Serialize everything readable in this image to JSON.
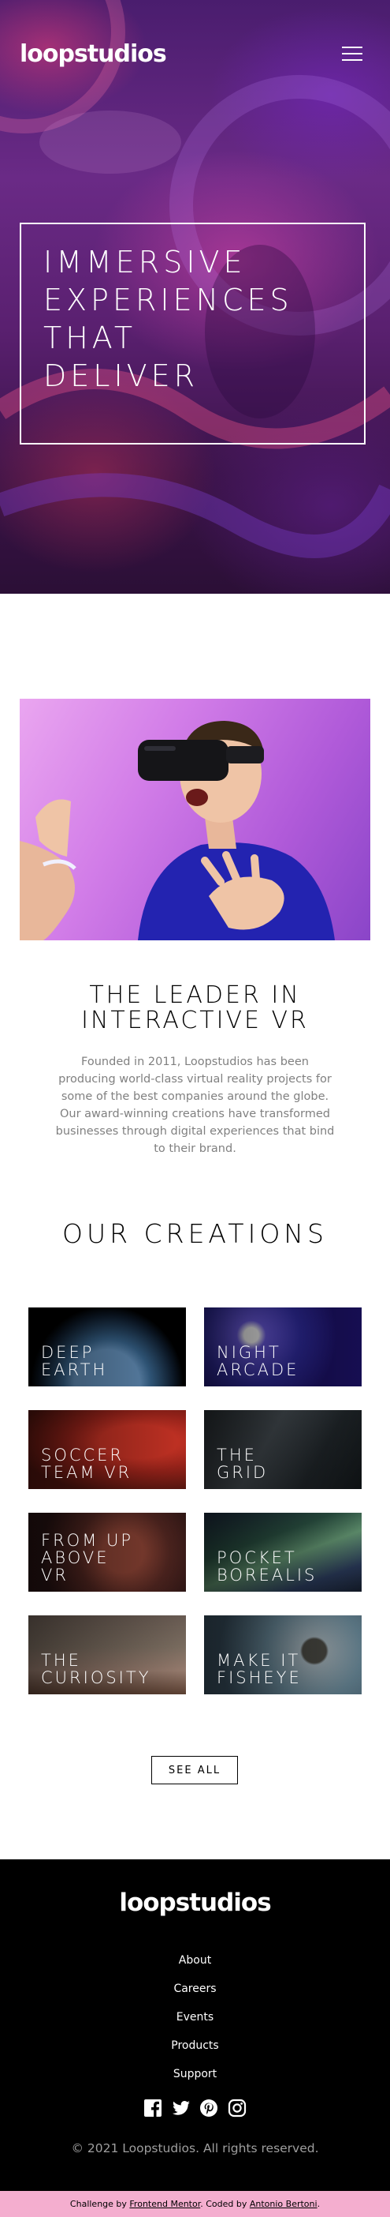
{
  "brand": {
    "logo": "loopstudios"
  },
  "hero": {
    "title_lines": [
      "IMMERSIVE",
      "EXPERIENCES",
      "THAT",
      "DELIVER"
    ]
  },
  "intro": {
    "title_lines": [
      "THE LEADER IN",
      "INTERACTIVE VR"
    ],
    "text": "Founded in 2011, Loopstudios has been producing world-class virtual reality projects for some of the best companies around the globe. Our award-winning creations have transformed businesses through digital experiences that bind to their brand."
  },
  "creations": {
    "title": "OUR CREATIONS",
    "items": [
      {
        "lines": [
          "DEEP",
          "EARTH"
        ]
      },
      {
        "lines": [
          "NIGHT",
          "ARCADE"
        ]
      },
      {
        "lines": [
          "SOCCER",
          "TEAM VR"
        ]
      },
      {
        "lines": [
          "THE",
          "GRID"
        ]
      },
      {
        "lines": [
          "FROM UP",
          "ABOVE",
          "VR"
        ]
      },
      {
        "lines": [
          "POCKET",
          "BOREALIS"
        ]
      },
      {
        "lines": [
          "THE",
          "CURIOSITY"
        ]
      },
      {
        "lines": [
          "MAKE IT",
          "FISHEYE"
        ]
      }
    ],
    "see_all": "SEE ALL"
  },
  "footer": {
    "logo": "loopstudios",
    "nav": [
      "About",
      "Careers",
      "Events",
      "Products",
      "Support"
    ],
    "socials": [
      "facebook-icon",
      "twitter-icon",
      "pinterest-icon",
      "instagram-icon"
    ],
    "copyright": "© 2021 Loopstudios. All rights reserved."
  },
  "attribution": {
    "prefix": "Challenge by",
    "link1": "Frontend Mentor",
    "middle": ". Coded by",
    "link2": "Antonio Bertoni",
    "suffix": "."
  }
}
